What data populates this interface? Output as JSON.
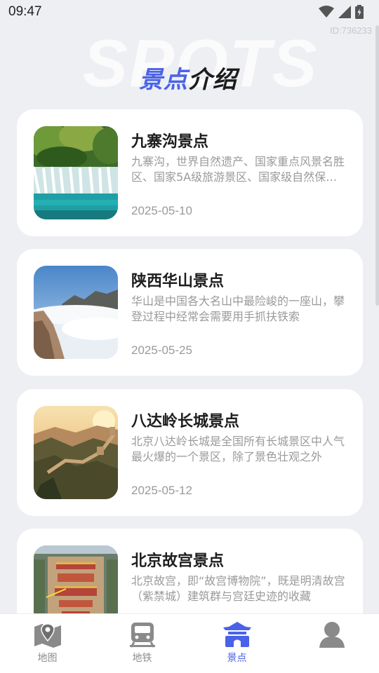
{
  "status": {
    "time": "09:47"
  },
  "watermark": "ID:736233",
  "background_word": "SPOTS",
  "title": {
    "accent": "景点",
    "main": "介绍"
  },
  "spots": [
    {
      "title": "九寨沟景点",
      "description": "九寨沟，世界自然遗产、国家重点风景名胜区、国家5A级旅游景区、国家级自然保护区、国家地质公园",
      "date": "2025-05-10",
      "image": "waterfall-lake-photo"
    },
    {
      "title": "陕西华山景点",
      "description": "华山是中国各大名山中最险峻的一座山，攀登过程中经常会需要用手抓扶铁索",
      "date": "2025-05-25",
      "image": "cloud-sea-mountain-photo"
    },
    {
      "title": "八达岭长城景点",
      "description": "北京八达岭长城是全国所有长城景区中人气最火爆的一个景区，除了景色壮观之外",
      "date": "2025-05-12",
      "image": "great-wall-sunset-photo"
    },
    {
      "title": "北京故宫景点",
      "description": "北京故宫，即“故宫博物院”，既是明清故宫（紫禁城）建筑群与宫廷史迹的收藏",
      "date": "",
      "image": "forbidden-city-aerial-photo"
    }
  ],
  "tabs": [
    {
      "label": "地图",
      "icon": "map-icon",
      "active": false
    },
    {
      "label": "地铁",
      "icon": "subway-icon",
      "active": false
    },
    {
      "label": "景点",
      "icon": "pavilion-icon",
      "active": true
    },
    {
      "label": "",
      "icon": "profile-icon",
      "active": false
    }
  ],
  "colors": {
    "accent": "#4a62e8",
    "inactive_icon": "#8a8a8a",
    "background": "#eeeff3"
  }
}
